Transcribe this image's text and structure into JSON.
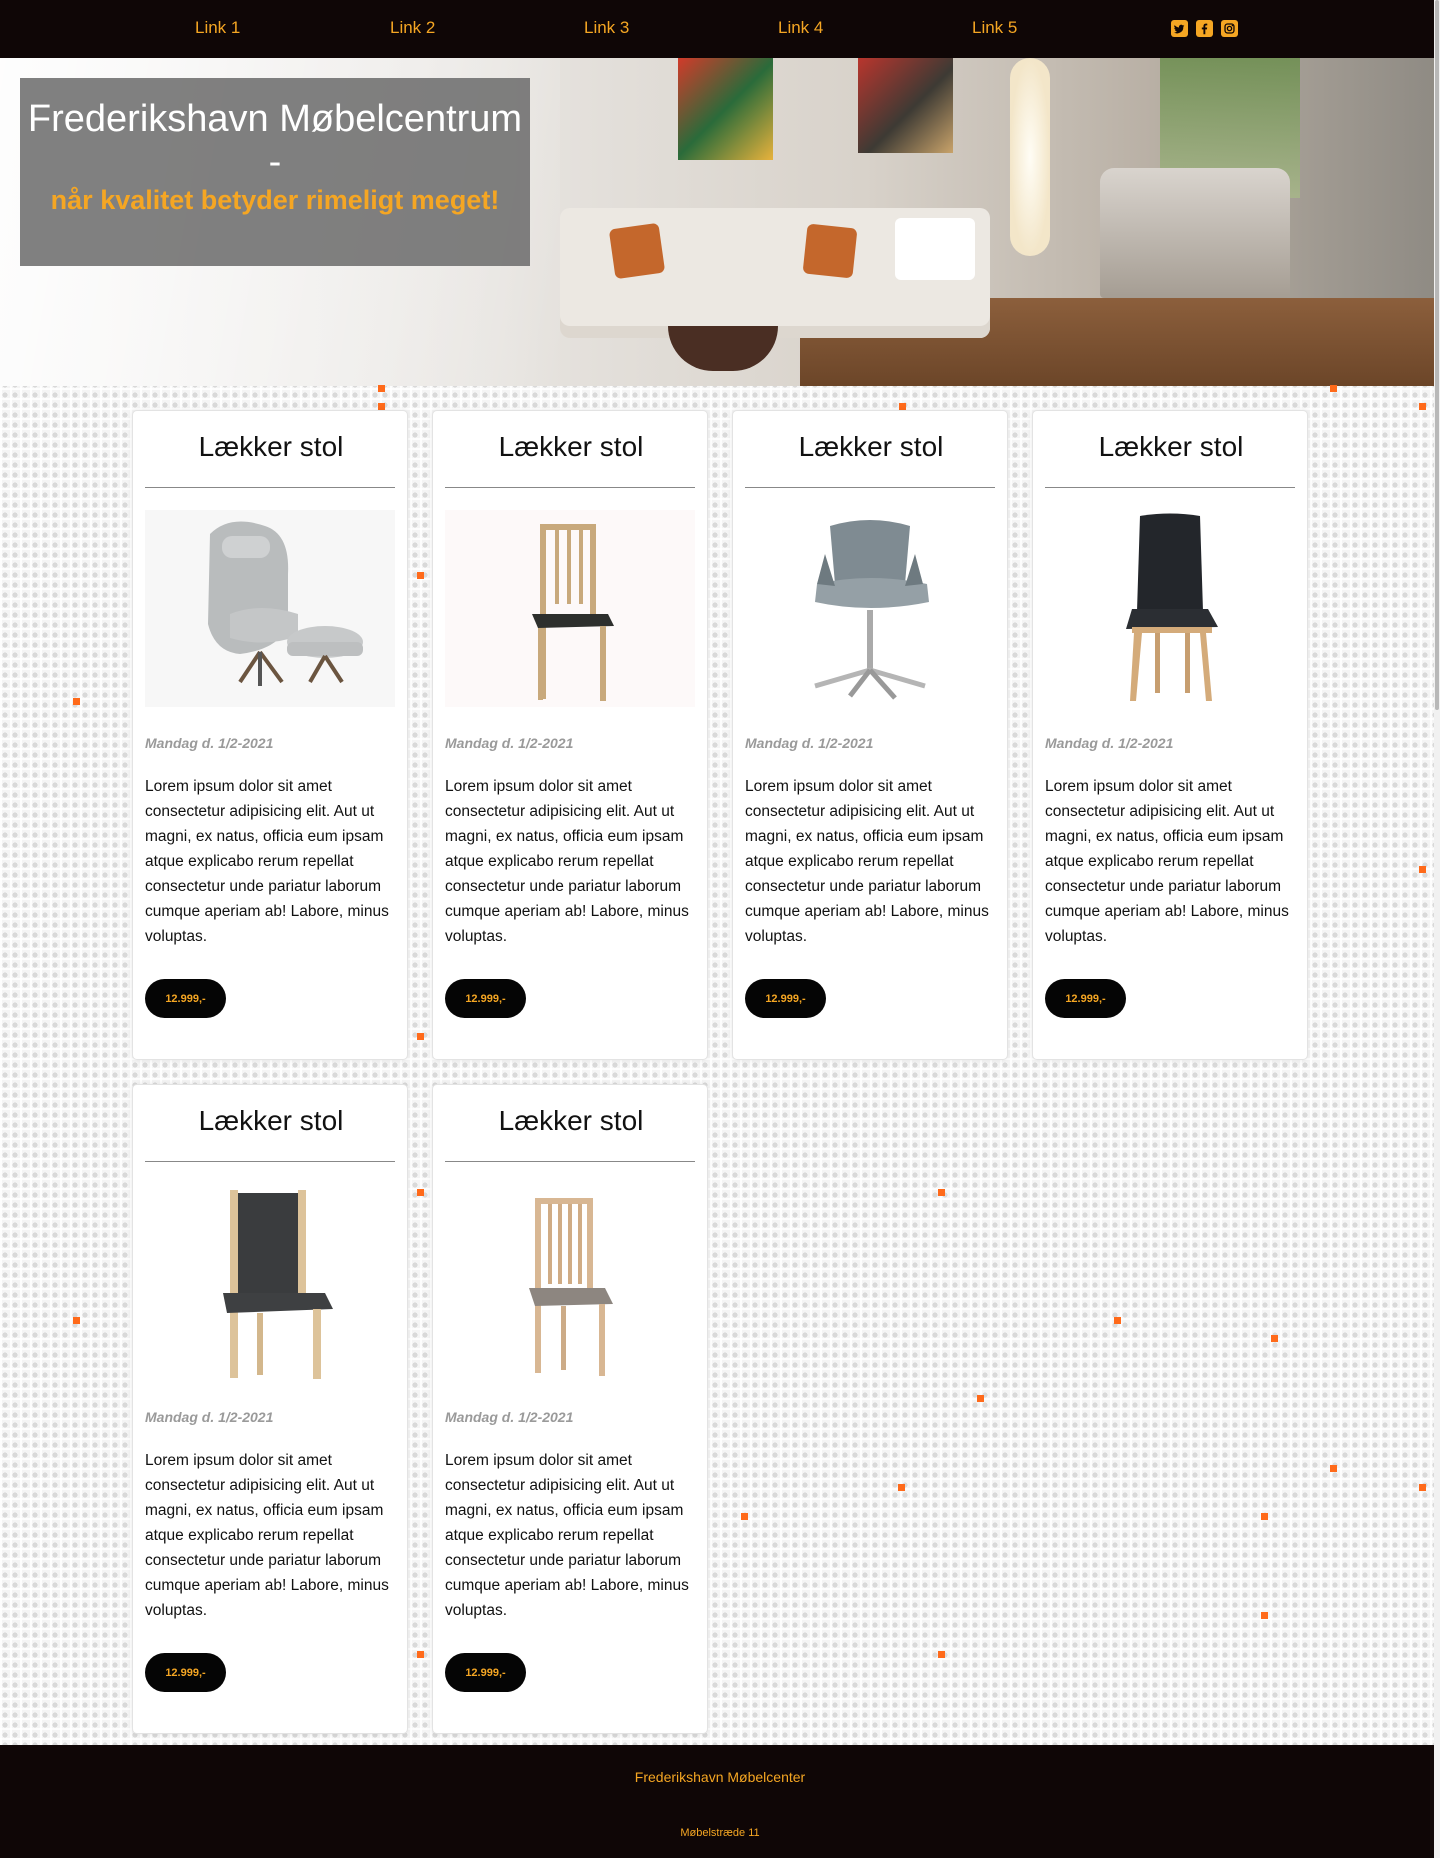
{
  "nav": {
    "links": [
      "Link 1",
      "Link 2",
      "Link 3",
      "Link 4",
      "Link 5"
    ],
    "social": [
      "twitter-icon",
      "facebook-icon",
      "instagram-icon"
    ]
  },
  "hero": {
    "title": "Frederikshavn Møbelcentrum -",
    "subtitle": "når kvalitet betyder rimeligt meget!"
  },
  "products": [
    {
      "title": "Lækker stol",
      "image": "armchair-with-ottoman",
      "date": "Mandag d. 1/2-2021",
      "text": "Lorem ipsum dolor sit amet consectetur adipisicing elit. Aut ut magni, ex natus, officia eum ipsam atque explicabo rerum repellat consectetur unde pariatur laborum cumque aperiam ab! Labore, minus voluptas.",
      "price": "12.999,-"
    },
    {
      "title": "Lækker stol",
      "image": "wooden-dining-chair",
      "date": "Mandag d. 1/2-2021",
      "text": "Lorem ipsum dolor sit amet consectetur adipisicing elit. Aut ut magni, ex natus, officia eum ipsam atque explicabo rerum repellat consectetur unde pariatur laborum cumque aperiam ab! Labore, minus voluptas.",
      "price": "12.999,-"
    },
    {
      "title": "Lækker stol",
      "image": "swivel-chair",
      "date": "Mandag d. 1/2-2021",
      "text": "Lorem ipsum dolor sit amet consectetur adipisicing elit. Aut ut magni, ex natus, officia eum ipsam atque explicabo rerum repellat consectetur unde pariatur laborum cumque aperiam ab! Labore, minus voluptas.",
      "price": "12.999,-"
    },
    {
      "title": "Lækker stol",
      "image": "leather-dining-chair",
      "date": "Mandag d. 1/2-2021",
      "text": "Lorem ipsum dolor sit amet consectetur adipisicing elit. Aut ut magni, ex natus, officia eum ipsam atque explicabo rerum repellat consectetur unde pariatur laborum cumque aperiam ab! Labore, minus voluptas.",
      "price": "12.999,-"
    },
    {
      "title": "Lækker stol",
      "image": "upholstered-dining-chair",
      "date": "Mandag d. 1/2-2021",
      "text": "Lorem ipsum dolor sit amet consectetur adipisicing elit. Aut ut magni, ex natus, officia eum ipsam atque explicabo rerum repellat consectetur unde pariatur laborum cumque aperiam ab! Labore, minus voluptas.",
      "price": "12.999,-"
    },
    {
      "title": "Lækker stol",
      "image": "slat-back-chair",
      "date": "Mandag d. 1/2-2021",
      "text": "Lorem ipsum dolor sit amet consectetur adipisicing elit. Aut ut magni, ex natus, officia eum ipsam atque explicabo rerum repellat consectetur unde pariatur laborum cumque aperiam ab! Labore, minus voluptas.",
      "price": "12.999,-"
    }
  ],
  "footer": {
    "name": "Frederikshavn Møbelcenter",
    "address": "Møbelstræde 11"
  },
  "colors": {
    "accent": "#f5a623",
    "nav_bg": "#0f0606",
    "button_bg": "#050505",
    "deco": "#ff6a1a"
  }
}
